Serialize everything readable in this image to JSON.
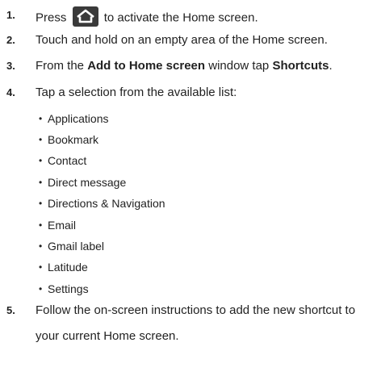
{
  "steps": [
    {
      "num": "1.",
      "pre": "Press",
      "icon": "home-key-icon",
      "post": "to activate the Home screen."
    },
    {
      "num": "2.",
      "text": "Touch and hold on an empty area of the Home screen."
    },
    {
      "num": "3.",
      "a": "From the ",
      "b1": "Add to Home screen",
      "c": " window tap ",
      "b2": "Shortcuts",
      "d": "."
    },
    {
      "num": "4.",
      "text": "Tap a selection from the available list:"
    },
    {
      "num": "5.",
      "line1": "Follow the on-screen instructions to add the new shortcut to",
      "line2": "your current Home screen."
    }
  ],
  "options": [
    "Applications",
    "Bookmark",
    "Contact",
    "Direct message",
    "Directions & Navigation",
    "Email",
    "Gmail label",
    "Latitude",
    "Settings"
  ],
  "bullet_glyph": "•",
  "colors": {
    "text": "#222222",
    "icon_bg": "#3a3a3a",
    "icon_fg": "#ffffff"
  }
}
